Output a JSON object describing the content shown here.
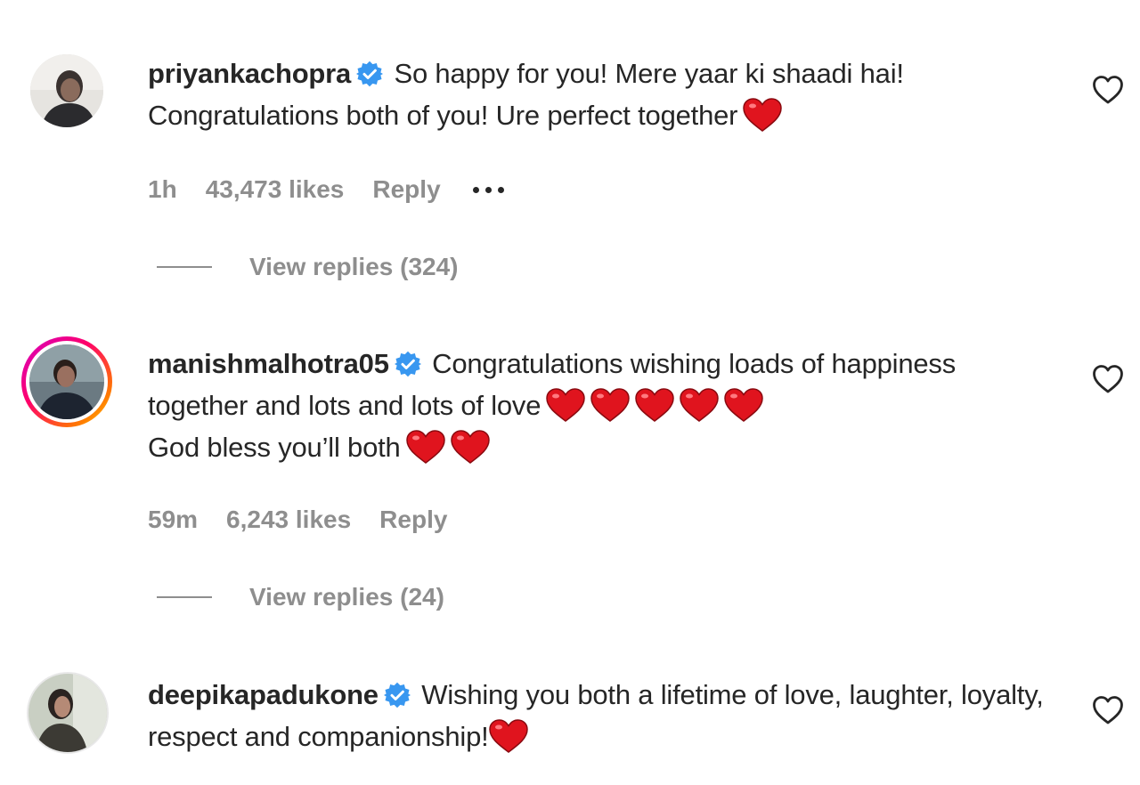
{
  "comments": [
    {
      "username": "priyankachopra",
      "verified": true,
      "text": "So happy for you! Mere yaar ki shaadi hai! Congratulations both of you! Ure perfect together",
      "time": "1h",
      "likes": "43,473 likes",
      "reply_label": "Reply",
      "view_replies": "View replies (324)",
      "hearts": 1,
      "avatar_ring": false
    },
    {
      "username": "manishmalhotra05",
      "verified": true,
      "text_line1": "Congratulations wishing loads of happiness together and lots and lots of love",
      "text_line2": "God bless you’ll both",
      "time": "59m",
      "likes": "6,243 likes",
      "reply_label": "Reply",
      "view_replies": "View replies (24)",
      "hearts_line1": 5,
      "hearts_line2": 2,
      "avatar_ring": true
    },
    {
      "username": "deepikapadukone",
      "verified": true,
      "text": "Wishing you both a lifetime of love, laughter, loyalty, respect and companionship!",
      "hearts": 1,
      "avatar_ring": false
    }
  ],
  "icons": {
    "verified": "verified-badge-icon",
    "like": "heart-outline-icon",
    "more": "more-options-icon",
    "emoji": "red-heart-emoji"
  },
  "colors": {
    "verified_blue": "#3897f0",
    "secondary_text": "#8e8e8e",
    "primary_text": "#262626",
    "heart_red": "#e0141e"
  }
}
